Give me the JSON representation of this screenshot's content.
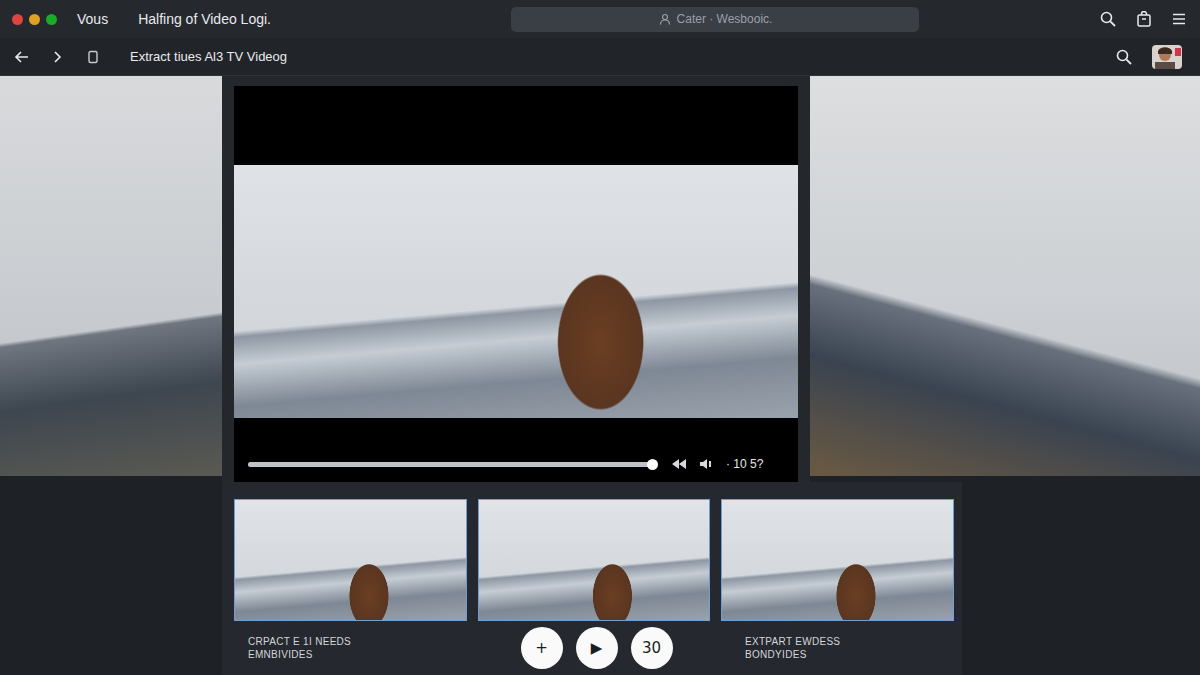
{
  "window": {
    "dots": [
      {
        "color": "#e0443e"
      },
      {
        "color": "#dea123"
      },
      {
        "color": "#1aab29"
      }
    ],
    "app": "Vous",
    "title": "Halfing of Video Logi."
  },
  "search": {
    "text": "Cater · Wesbooic."
  },
  "nav": {
    "title": "Extract tiues Al3 TV Videog"
  },
  "player": {
    "level": 0.985,
    "time": "· 10 5?"
  },
  "thumbnails": [
    {
      "selected": false
    },
    {
      "selected": false
    },
    {
      "selected": false
    }
  ],
  "captions": [
    {
      "lines": [
        "CRPACT E 1I NEEDS",
        "EMNBIVIDES"
      ]
    },
    {
      "lines": [
        "EXTPART EWDESS",
        "BONDYIDES"
      ]
    }
  ],
  "buttons": [
    "+",
    "▶",
    "30"
  ]
}
